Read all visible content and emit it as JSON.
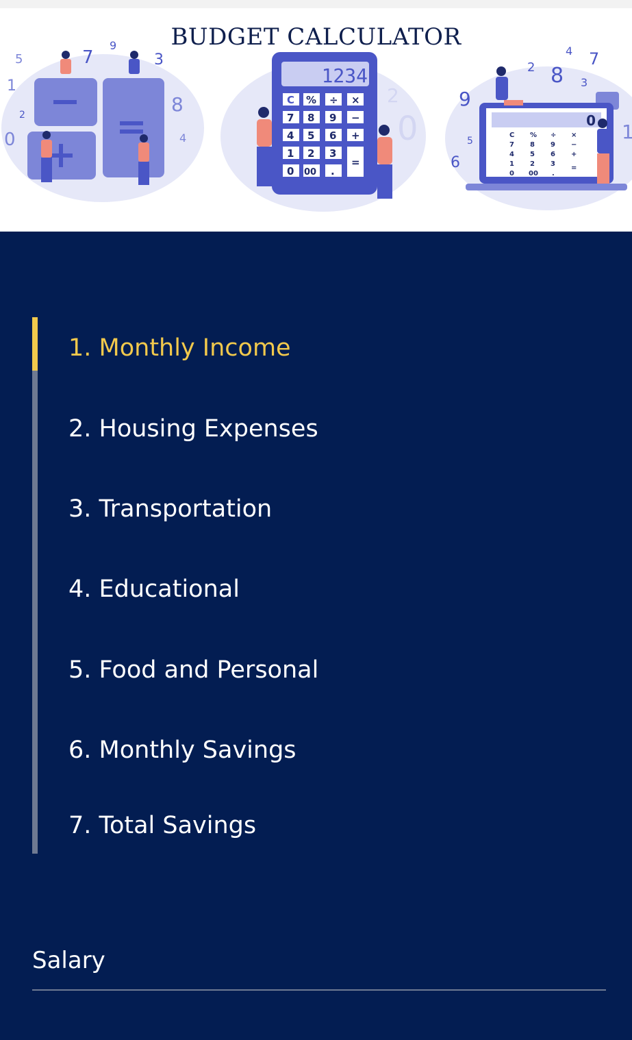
{
  "header": {
    "title": "BUDGET CALCULATOR",
    "calculator_display": "1234",
    "laptop_display": "0"
  },
  "steps": [
    {
      "label": "1. Monthly Income",
      "active": true
    },
    {
      "label": "2. Housing Expenses",
      "active": false
    },
    {
      "label": "3. Transportation",
      "active": false
    },
    {
      "label": "4. Educational",
      "active": false
    },
    {
      "label": "5. Food and Personal",
      "active": false
    },
    {
      "label": "6. Monthly Savings",
      "active": false
    },
    {
      "label": "7. Total Savings",
      "active": false
    }
  ],
  "form": {
    "salary_label": "Salary",
    "salary_value": ""
  },
  "colors": {
    "panel_bg": "#031d52",
    "active_step": "#f2c94c",
    "track": "#6f7a92",
    "illustration_primary": "#4a56c6",
    "illustration_light": "#dfe2f7",
    "illustration_accent": "#f08a7a"
  }
}
